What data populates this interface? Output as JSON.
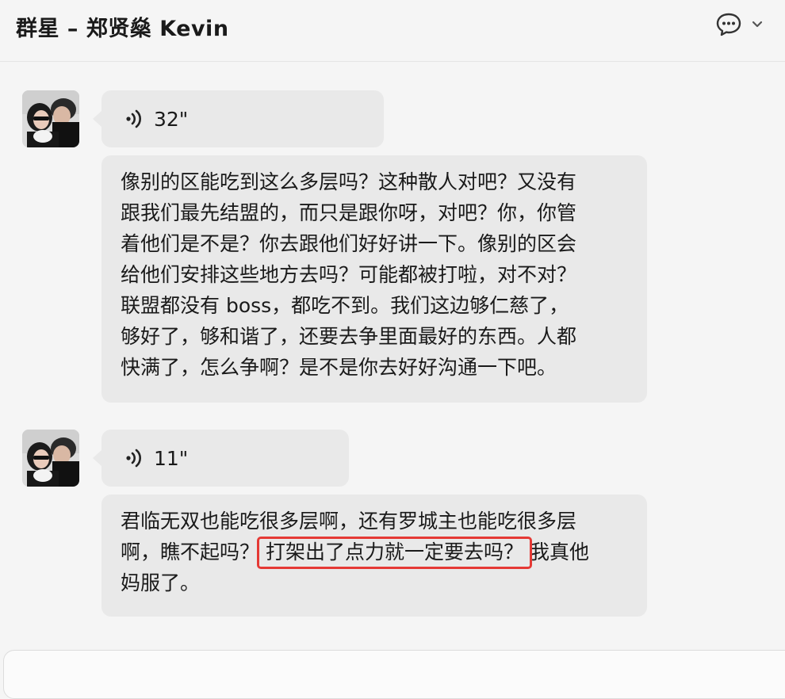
{
  "header": {
    "title": "群星 – 郑贤燊 Kevin",
    "chat_icon": "chat-bubble-icon",
    "dropdown_icon": "chevron-down-icon"
  },
  "messages": [
    {
      "voice": {
        "icon": "voice-wave-icon",
        "duration": "32\""
      },
      "text": "像别的区能吃到这么多层吗？这种散人对吧？又没有\n跟我们最先结盟的，而只是跟你呀，对吧？你，你管\n着他们是不是？你去跟他们好好讲一下。像别的区会\n给他们安排这些地方去吗？可能都被打啦，对不对？\n联盟都没有 boss，都吃不到。我们这边够仁慈了，\n够好了，够和谐了，还要去争里面最好的东西。人都\n快满了，怎么争啊？是不是你去好好沟通一下吧。"
    },
    {
      "voice": {
        "icon": "voice-wave-icon",
        "duration": "11\""
      },
      "text_before": "君临无双也能吃很多层啊，还有罗城主也能吃很多层\n啊，瞧不起吗？",
      "text_highlight": "打架出了点力就一定要去吗？",
      "text_after": "我真他\n妈服了。"
    }
  ],
  "colors": {
    "bubble": "#e9e9e9",
    "highlight_box": "#e53935",
    "background": "#f5f5f5"
  }
}
